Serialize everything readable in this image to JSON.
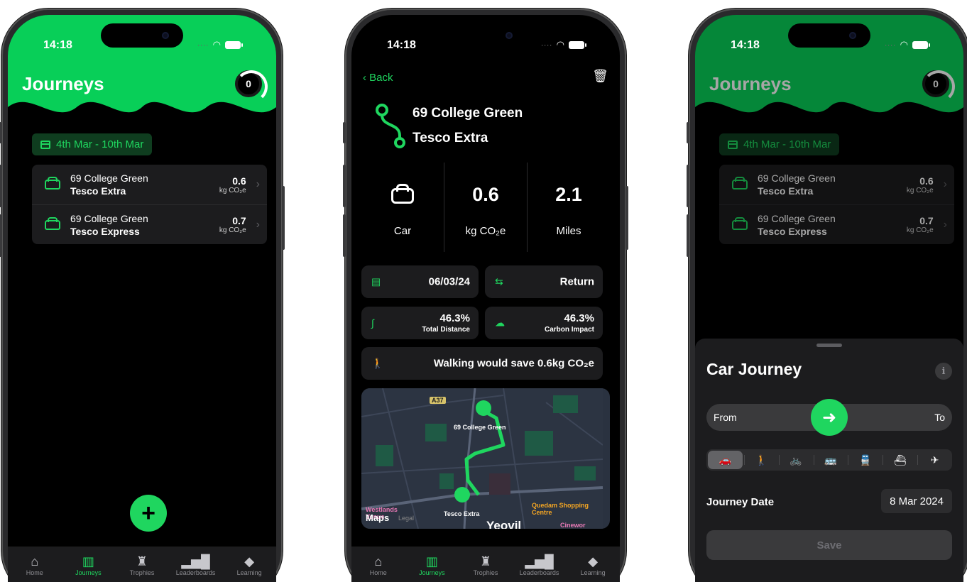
{
  "status": {
    "time": "14:18"
  },
  "phone1": {
    "title": "Journeys",
    "score": "0",
    "date_range": "4th Mar - 10th Mar",
    "journeys": [
      {
        "from": "69 College Green",
        "to": "Tesco Extra",
        "value": "0.6",
        "unit": "kg CO₂e"
      },
      {
        "from": "69 College Green",
        "to": "Tesco Express",
        "value": "0.7",
        "unit": "kg CO₂e"
      }
    ],
    "fab": "+"
  },
  "tabs": [
    {
      "label": "Home",
      "icon": "house-icon"
    },
    {
      "label": "Journeys",
      "icon": "map-icon"
    },
    {
      "label": "Trophies",
      "icon": "trophy-icon"
    },
    {
      "label": "Leaderboards",
      "icon": "bar-chart-icon"
    },
    {
      "label": "Learning",
      "icon": "graduation-cap-icon"
    }
  ],
  "phone2": {
    "back": "Back",
    "from": "69 College Green",
    "to": "Tesco Extra",
    "mode": "Car",
    "emission": "0.6",
    "emission_unit": "kg CO₂e",
    "distance": "2.1",
    "distance_unit": "Miles",
    "date": "06/03/24",
    "trip_type": "Return",
    "total_distance_pct": "46.3%",
    "total_distance_label": "Total Distance",
    "carbon_impact_pct": "46.3%",
    "carbon_impact_label": "Carbon Impact",
    "walking_tip": "Walking would save 0.6kg CO₂e",
    "map": {
      "origin_label": "69 College Green",
      "dest_label": "Tesco Extra",
      "road_label": "A37",
      "poi1": "Quedam Shopping Centre",
      "poi2": "Cinewor",
      "poi3": "Westlands Venue",
      "town": "Yeovil",
      "legal": "Legal",
      "brand": "Maps"
    }
  },
  "phone3": {
    "sheet_title": "Car Journey",
    "info": "i",
    "from": "From",
    "to": "To",
    "modes": [
      "car-icon",
      "walk-icon",
      "bike-icon",
      "bus-icon",
      "train-icon",
      "ferry-icon",
      "plane-icon"
    ],
    "journey_date_label": "Journey Date",
    "journey_date": "8 Mar 2024",
    "save": "Save"
  },
  "colors": {
    "accent": "#1fd65f",
    "background": "#000000",
    "card": "#1c1c1e"
  }
}
